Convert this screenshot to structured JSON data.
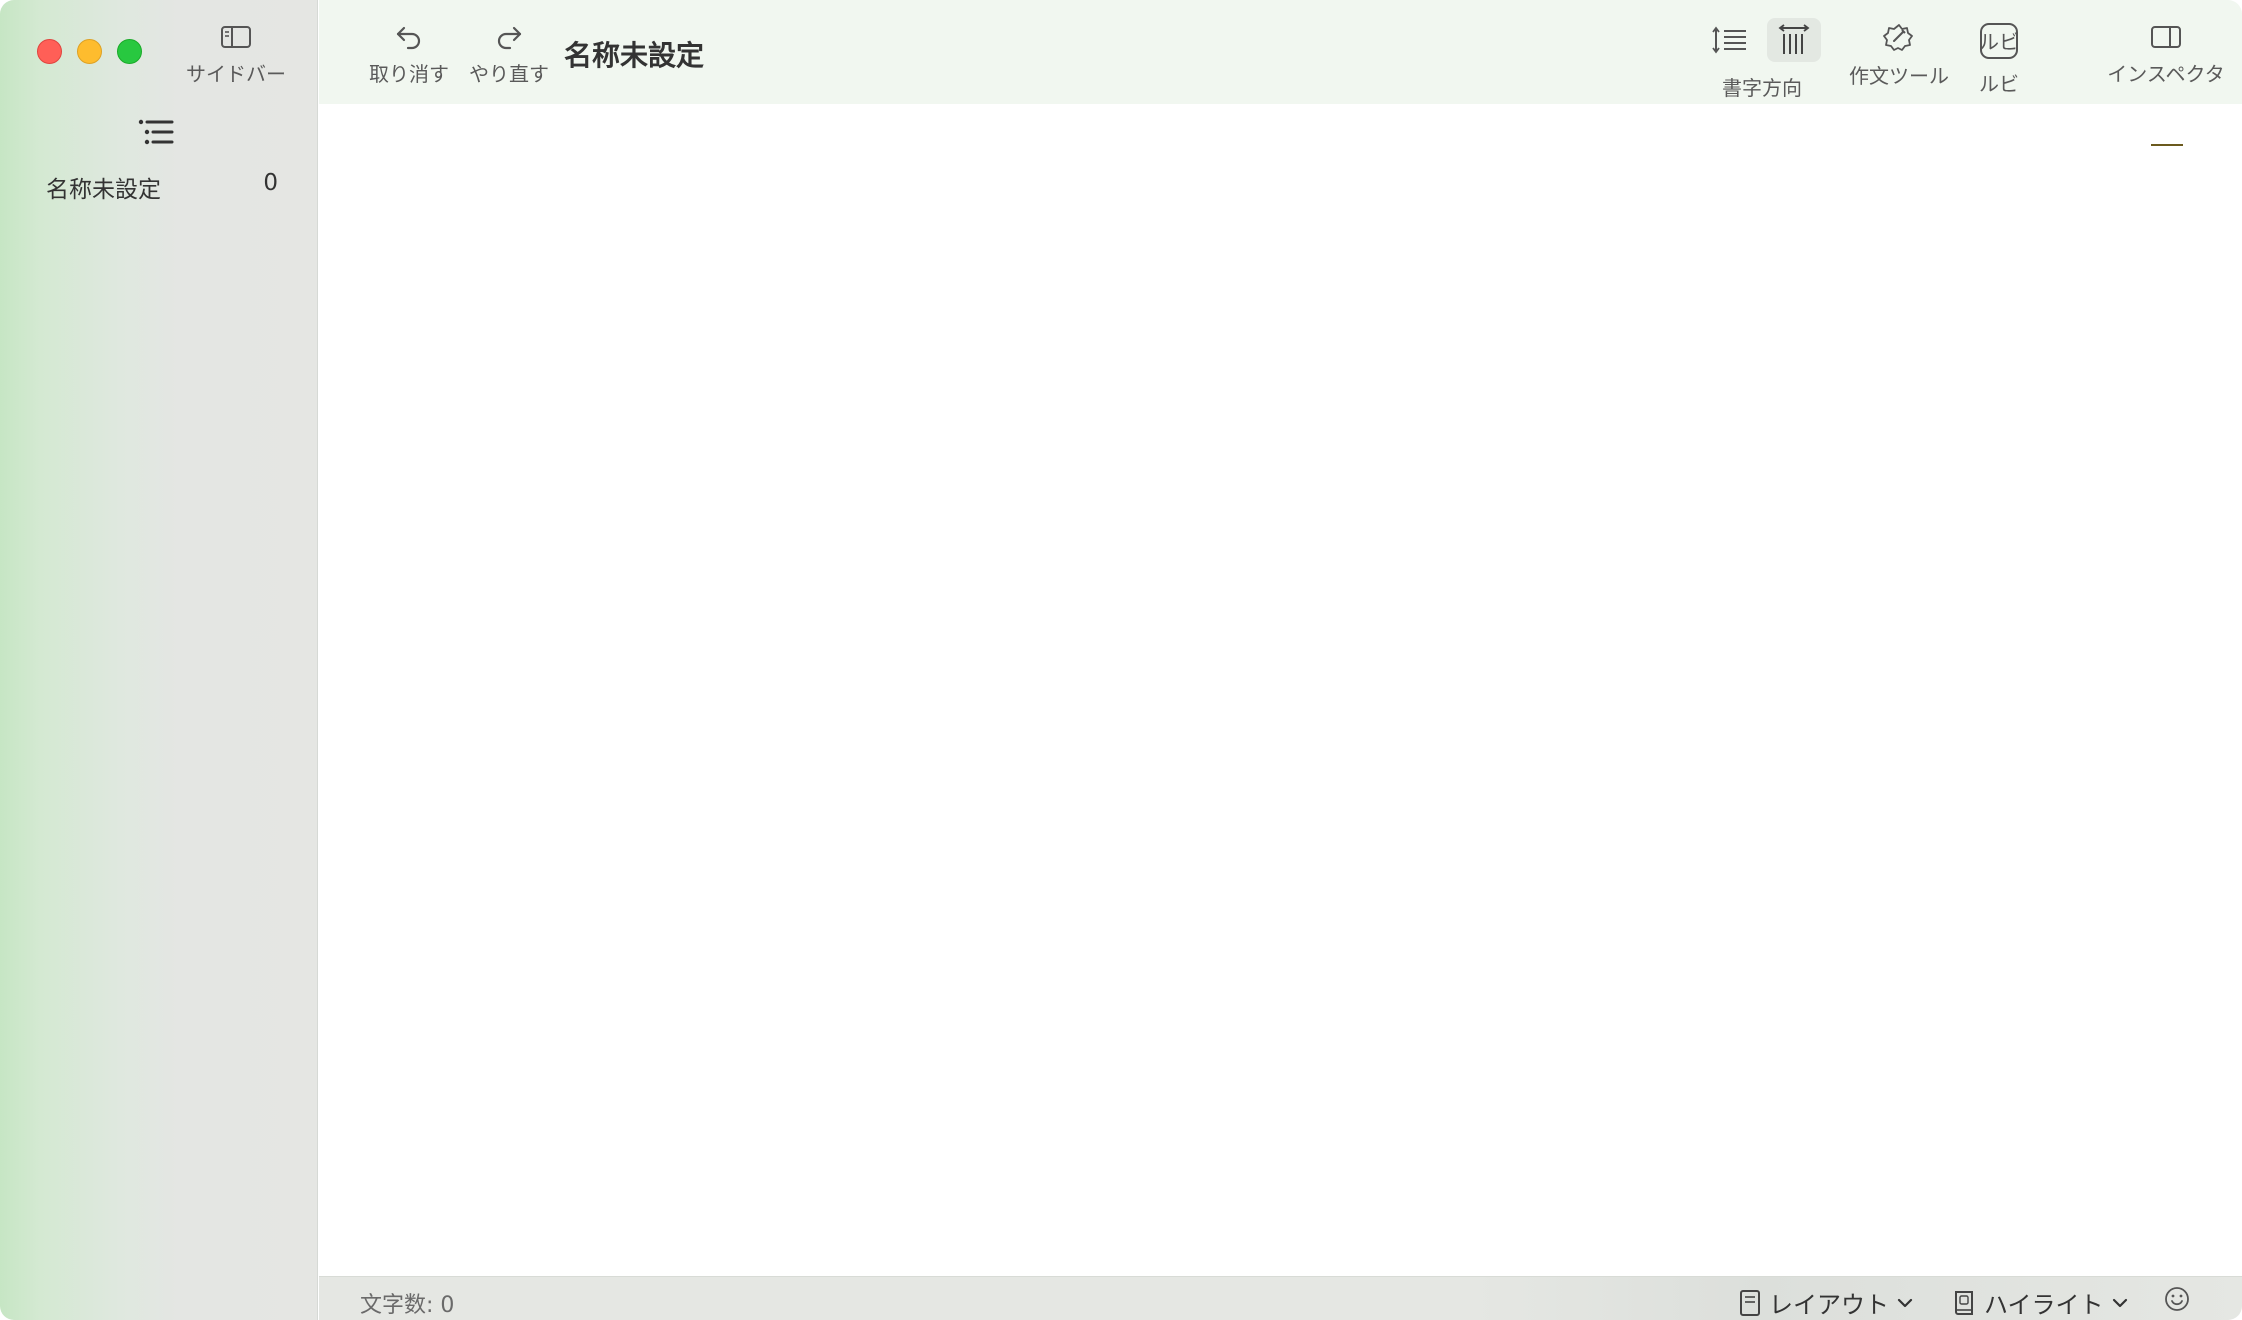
{
  "sidebar": {
    "toggle_label": "サイドバー",
    "documents": [
      {
        "title": "名称未設定",
        "count": "0"
      }
    ]
  },
  "toolbar": {
    "undo_label": "取り消す",
    "redo_label": "やり直す",
    "document_title": "名称未設定",
    "direction_label": "書字方向",
    "writing_tools_label": "作文ツール",
    "ruby_label": "ルビ",
    "ruby_icon_text": "ルビ",
    "inspector_label": "インスペクタ"
  },
  "statusbar": {
    "char_count": "文字数: 0",
    "layout_label": "レイアウト",
    "highlight_label": "ハイライト"
  },
  "colors": {
    "sidebar_bg": "#e5e6e3",
    "toolbar_bg": "#f1f7f0",
    "close": "#ff5f57",
    "minimize": "#febc2e",
    "zoom": "#28c840",
    "caret": "#6b5a1e"
  }
}
